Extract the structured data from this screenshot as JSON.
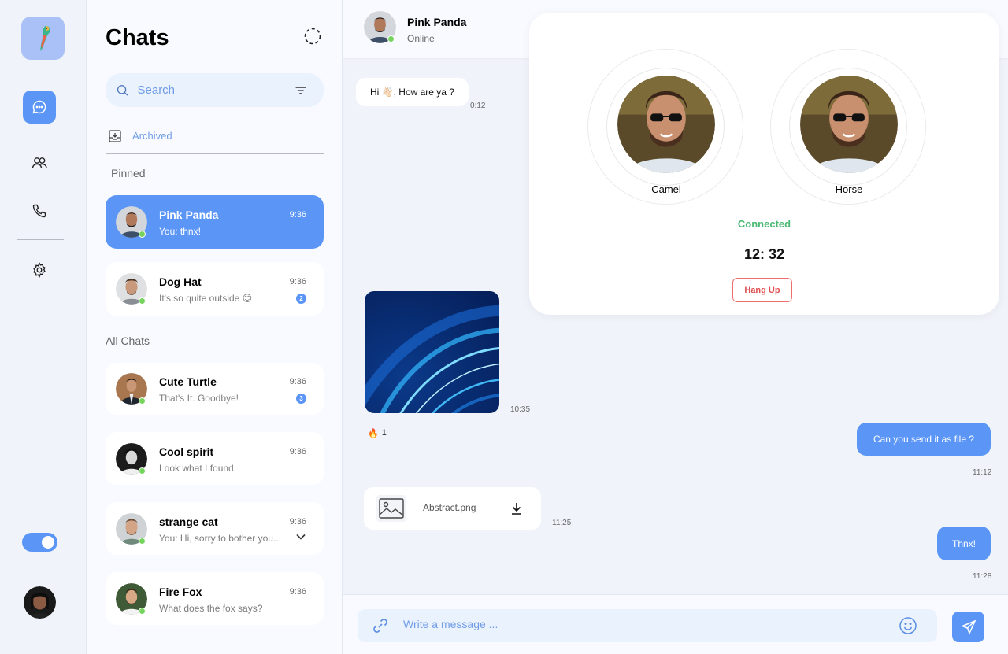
{
  "sidebar": {
    "toggle_on": true
  },
  "chats": {
    "title": "Chats",
    "search_placeholder": "Search",
    "archived_label": "Archived",
    "pinned_label": "Pinned",
    "all_label": "All Chats",
    "pinned": [
      {
        "name": "Pink Panda",
        "message": "You: thnx!",
        "time": "9:36",
        "online": true,
        "badge": "",
        "active": true
      },
      {
        "name": "Dog Hat",
        "message": "It's so quite outside 😊",
        "time": "9:36",
        "online": true,
        "badge": "2",
        "active": false
      }
    ],
    "all": [
      {
        "name": "Cute Turtle",
        "message": "That's It. Goodbye!",
        "time": "9:36",
        "online": true,
        "badge": "3"
      },
      {
        "name": "Cool spirit",
        "message": "Look what I found",
        "time": "9:36",
        "online": true,
        "badge": ""
      },
      {
        "name": "strange cat",
        "message": "You: Hi, sorry to bother you..",
        "time": "9:36",
        "online": true,
        "badge": ""
      },
      {
        "name": "Fire Fox",
        "message": "What does the fox says?",
        "time": "9:36",
        "online": true,
        "badge": ""
      }
    ]
  },
  "conversation": {
    "contact_name": "Pink Panda",
    "contact_status": "Online",
    "messages": {
      "greeting": {
        "text": "Hi 👋🏻, How are ya ?",
        "time": "0:12"
      },
      "image_time": "10:35",
      "reaction": {
        "emoji": "🔥",
        "count": "1"
      },
      "request": {
        "text": "Can you send it as file ?",
        "time": "11:12"
      },
      "file": {
        "name": "Abstract.png",
        "time": "11:25"
      },
      "thanks": {
        "text": "Thnx!",
        "time": "11:28"
      }
    },
    "composer_placeholder": "Write a message ..."
  },
  "call": {
    "caller_left": "Camel",
    "caller_right": "Horse",
    "status": "Connected",
    "duration": "12: 32",
    "hangup_label": "Hang Up"
  },
  "colors": {
    "accent": "#5b96f7",
    "online": "#76d45e",
    "connected": "#4ab873",
    "hangup": "#e05050"
  }
}
